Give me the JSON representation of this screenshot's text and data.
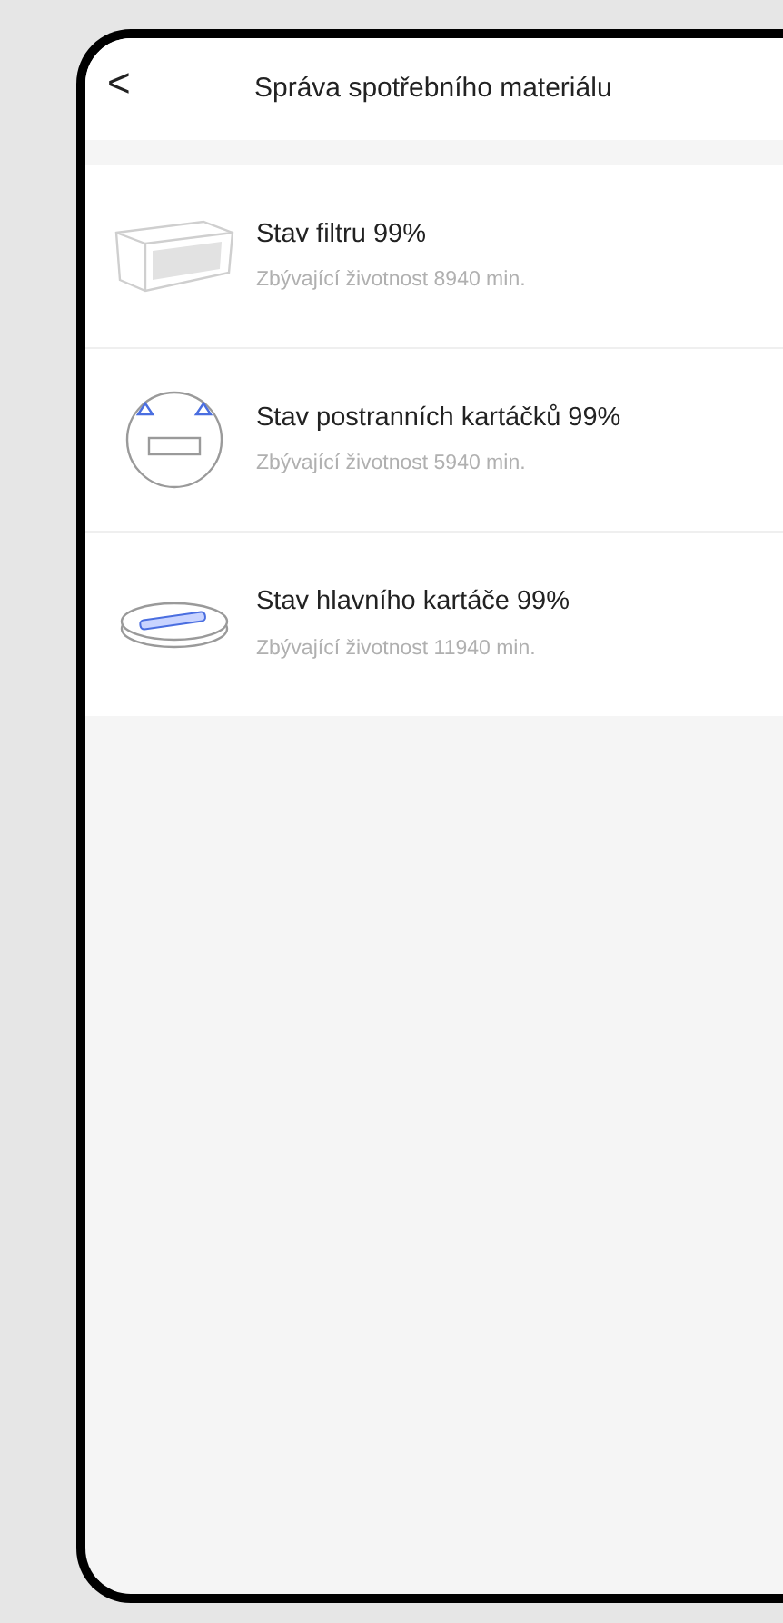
{
  "header": {
    "back": "<",
    "title": "Správa spotřebního materiálu"
  },
  "items": [
    {
      "kind": "filter",
      "title": "Stav filtru 99%",
      "subtitle": "Zbývající životnost 8940 min."
    },
    {
      "kind": "side_brush",
      "title": "Stav postranních kartáčků 99%",
      "subtitle": "Zbývající životnost 5940 min."
    },
    {
      "kind": "main_brush",
      "title": "Stav hlavního kartáče 99%",
      "subtitle": "Zbývající životnost 11940 min."
    }
  ]
}
